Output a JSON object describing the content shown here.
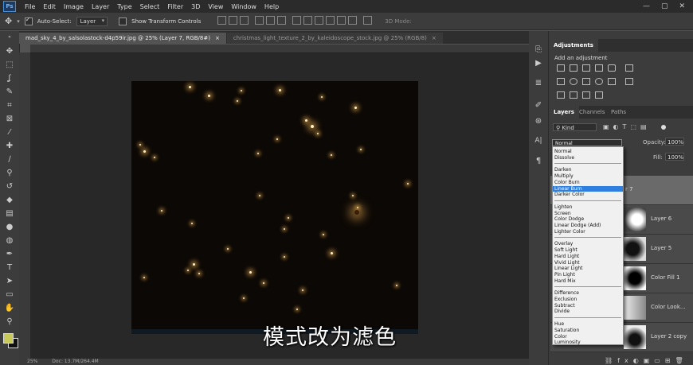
{
  "menubar": {
    "logo": "Ps",
    "items": [
      "File",
      "Edit",
      "Image",
      "Layer",
      "Type",
      "Select",
      "Filter",
      "3D",
      "View",
      "Window",
      "Help"
    ],
    "window_controls": [
      "—",
      "▢",
      "✕"
    ]
  },
  "options": {
    "auto_select_label": "Auto-Select:",
    "auto_select_value": "Layer",
    "transform_label": "Show Transform Controls",
    "mode_3d": "3D Mode:"
  },
  "tabs": [
    {
      "label": "mad_sky_4_by_salsolastock-d4p59ir.jpg @ 25% (Layer 7, RGB/8#)",
      "active": true
    },
    {
      "label": "christmas_light_texture_2_by_kaleidoscope_stock.jpg @ 25% (RGB/8)",
      "active": false
    }
  ],
  "status": {
    "zoom": "25%",
    "doc": "Doc: 13.7M/264.4M"
  },
  "subtitle": "模式改为滤色",
  "panels": {
    "adjustments_title": "Adjustments",
    "add_adjustment": "Add an adjustment",
    "layers_tabs": [
      "Layers",
      "Channels",
      "Paths"
    ],
    "kind_label": "Kind",
    "blend_mode": "Normal",
    "opacity_label": "Opacity:",
    "opacity_value": "100%",
    "fill_label": "Fill:",
    "fill_value": "100%",
    "layer_partial": "r 7",
    "layers": [
      "Layer 6",
      "Layer 5",
      "Color Fill 1",
      "Color Look...",
      "Layer 2 copy"
    ]
  },
  "blend_dropdown": {
    "groups": [
      [
        "Normal",
        "Dissolve"
      ],
      [
        "Darken",
        "Multiply",
        "Color Burn",
        "Linear Burn",
        "Darker Color"
      ],
      [
        "Lighten",
        "Screen",
        "Color Dodge",
        "Linear Dodge (Add)",
        "Lighter Color"
      ],
      [
        "Overlay",
        "Soft Light",
        "Hard Light",
        "Vivid Light",
        "Linear Light",
        "Pin Light",
        "Hard Mix"
      ],
      [
        "Difference",
        "Exclusion",
        "Subtract",
        "Divide"
      ],
      [
        "Hue",
        "Saturation",
        "Color",
        "Luminosity"
      ]
    ],
    "highlighted": "Linear Burn"
  },
  "colors": {
    "foreground": "#c9c95a",
    "background": "#111111",
    "highlight": "#2f7fe0"
  }
}
